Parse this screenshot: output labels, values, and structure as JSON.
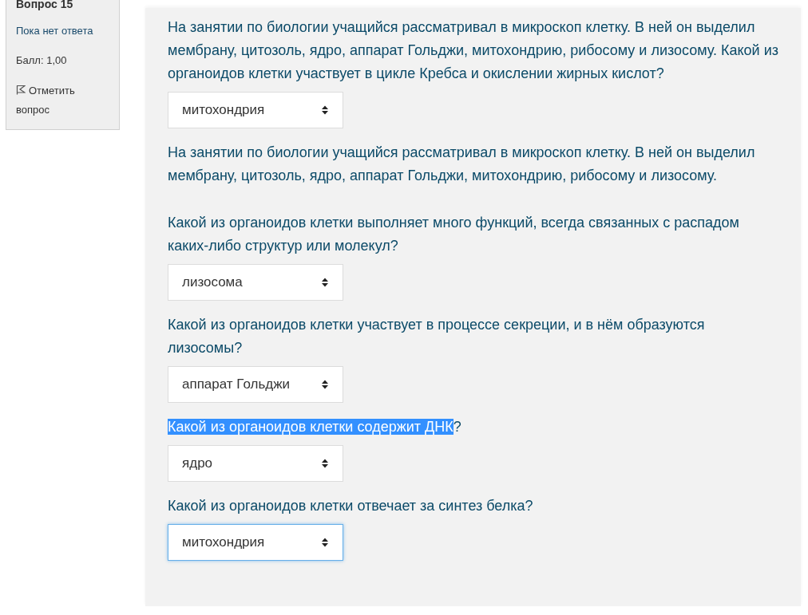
{
  "sidebar": {
    "question_number": "Вопрос 15",
    "status": "Пока нет ответа",
    "score": "Балл: 1,00",
    "flag_link": "Отметить вопрос"
  },
  "items": [
    {
      "kind": "text",
      "text": "На занятии по биологии учащийся рассматривал в микроскоп клетку. В ней он выделил мембрану, цитозоль, ядро, аппарат Гольджи, митохондрию, рибосому и лизосому. Какой из органоидов клетки участвует в цикле Кребса и окислении жирных кислот?"
    },
    {
      "kind": "select",
      "value": "митохондрия",
      "focused": false
    },
    {
      "kind": "text",
      "text": "На занятии по биологии учащийся рассматривал в микроскоп клетку. В ней он выделил мембрану, цитозоль, ядро, аппарат Гольджи, митохондрию, рибосому и лизосому."
    },
    {
      "kind": "text",
      "text": "Какой из органоидов клетки выполняет много функций, всегда связанных с распадом каких-либо структур или молекул?"
    },
    {
      "kind": "select",
      "value": "лизосома",
      "focused": false
    },
    {
      "kind": "text",
      "text": "Какой из органоидов клетки участвует в процессе секреции, и в нём образуются лизосомы?"
    },
    {
      "kind": "select",
      "value": "аппарат Гольджи",
      "focused": false
    },
    {
      "kind": "text",
      "parts": [
        {
          "text": "Какой из органоидов клетки содержит ДНК",
          "highlighted": true
        },
        {
          "text": "?",
          "highlighted": false
        }
      ]
    },
    {
      "kind": "select",
      "value": "ядро",
      "focused": false
    },
    {
      "kind": "text",
      "text": "Какой из органоидов клетки отвечает за синтез белка?"
    },
    {
      "kind": "select",
      "value": "митохондрия",
      "focused": true
    }
  ]
}
